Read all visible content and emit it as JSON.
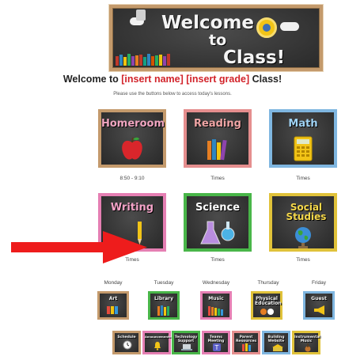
{
  "banner": {
    "line1": "Welcome",
    "line2": "to",
    "line3": "Class!"
  },
  "heading": {
    "prefix": "Welcome to ",
    "name_placeholder": "[insert name]",
    "grade_placeholder": "[insert grade]",
    "suffix": " Class!"
  },
  "instruction": "Please use the buttons below to access today's lessons.",
  "boards": [
    {
      "title": "Homeroom",
      "caption": "8:50 - 9:10",
      "frame": "#c49a6c",
      "title_color": "#f0a5c0"
    },
    {
      "title": "Reading",
      "caption": "Times",
      "frame": "#e58e8e",
      "title_color": "#f0a5a5"
    },
    {
      "title": "Math",
      "caption": "Times",
      "frame": "#7fb6e0",
      "title_color": "#9fd3f5"
    },
    {
      "title": "Writing",
      "caption": "Times",
      "frame": "#e57fb3",
      "title_color": "#f4a3c8"
    },
    {
      "title": "Science",
      "caption": "Times",
      "frame": "#49b649",
      "title_color": "#ffffff"
    },
    {
      "title": "Social Studies",
      "caption": "Times",
      "frame": "#e0c23a",
      "title_color": "#f5d84a"
    }
  ],
  "days": [
    "Monday",
    "Tuesday",
    "Wednesday",
    "Thursday",
    "Friday"
  ],
  "specials": [
    {
      "title": "Art",
      "frame": "#c49a6c"
    },
    {
      "title": "Library",
      "frame": "#49b649"
    },
    {
      "title": "Music",
      "frame": "#e57fb3"
    },
    {
      "title": "Physical Education",
      "frame": "#e0c23a"
    },
    {
      "title": "Guest",
      "frame": "#7fb6e0"
    }
  ],
  "extras": [
    {
      "title": "Schedule",
      "frame": "#c49a6c"
    },
    {
      "title": "Announcements",
      "frame": "#e57fb3"
    },
    {
      "title": "Technology Support",
      "frame": "#49b649"
    },
    {
      "title": "Teams Meeting",
      "frame": "#e57fb3"
    },
    {
      "title": "Parent Resources",
      "frame": "#e58e8e"
    },
    {
      "title": "Building Website",
      "frame": "#7fb6e0"
    },
    {
      "title": "Instrumental Music",
      "frame": "#e0c23a"
    }
  ],
  "colors": {
    "accent_red": "#d2232a",
    "arrow": "#ee1c1c",
    "chalkboard": "#333333"
  }
}
